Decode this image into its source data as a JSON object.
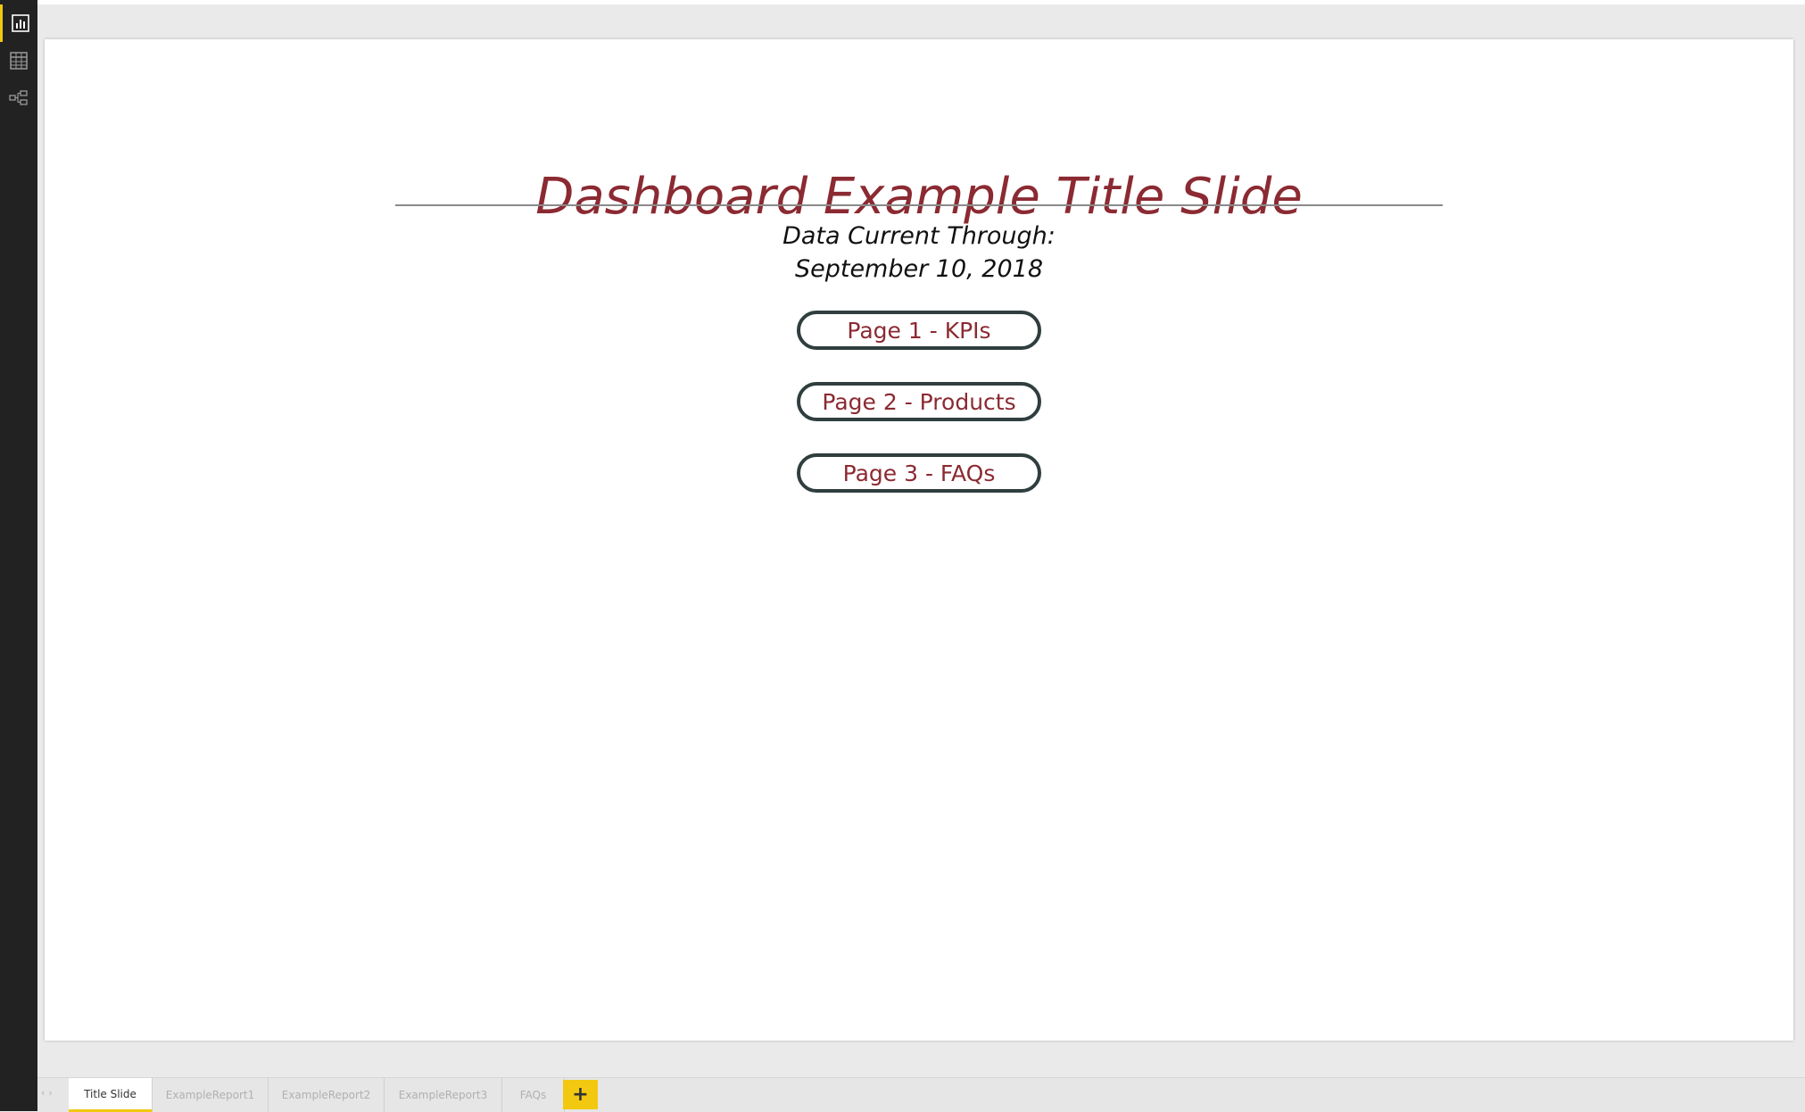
{
  "rail": {
    "items": [
      {
        "icon": "report-view-icon",
        "active": true
      },
      {
        "icon": "data-view-icon",
        "active": false
      },
      {
        "icon": "model-view-icon",
        "active": false
      }
    ]
  },
  "canvas": {
    "title": "Dashboard Example Title Slide",
    "subtitle_line1": "Data Current Through:",
    "subtitle_line2": "September 10, 2018",
    "buttons": [
      {
        "label": "Page 1 - KPIs"
      },
      {
        "label": "Page 2 - Products"
      },
      {
        "label": "Page 3 - FAQs"
      }
    ]
  },
  "tabs": {
    "items": [
      {
        "label": "Title Slide",
        "active": true
      },
      {
        "label": "ExampleReport1",
        "active": false
      },
      {
        "label": "ExampleReport2",
        "active": false
      },
      {
        "label": "ExampleReport3",
        "active": false
      },
      {
        "label": "FAQs",
        "active": false
      }
    ],
    "add_label": "+",
    "scroll_prev": "‹",
    "scroll_next": "›"
  },
  "colors": {
    "accent": "#f2c811",
    "title": "#8b2a32",
    "button_border": "#2f3e3e",
    "rail": "#222222"
  }
}
